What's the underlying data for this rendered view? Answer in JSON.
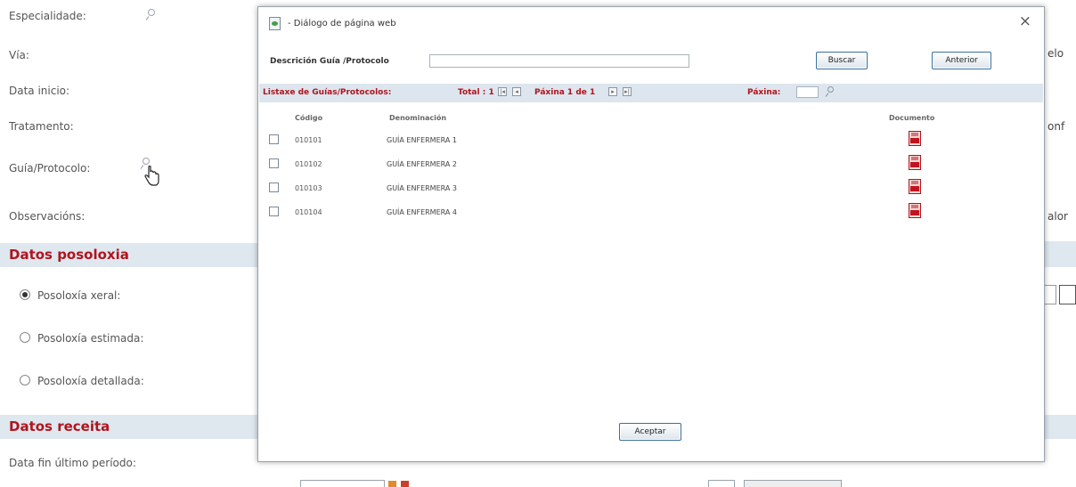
{
  "form": {
    "especialidade": "Especialidade:",
    "via": "Vía:",
    "data_inicio": "Data inicio:",
    "tratamento": "Tratamento:",
    "guia_protocolo": "Guía/Protocolo:",
    "observacions": "Observacións:",
    "right_fragments": {
      "elo": "elo",
      "onf": "onf",
      "alor": "alor"
    }
  },
  "sections": {
    "posoloxia": "Datos posoloxia",
    "receita": "Datos receita"
  },
  "posoloxia_options": [
    {
      "label": "Posoloxía xeral:",
      "selected": true
    },
    {
      "label": "Posoloxía estimada:",
      "selected": false
    },
    {
      "label": "Posoloxía detallada:",
      "selected": false
    }
  ],
  "receita": {
    "data_fin": "Data fin último período:"
  },
  "dialog": {
    "title": "- Diálogo de página web",
    "close": "×",
    "search_label": "Descrición Guía /Protocolo",
    "search_value": "",
    "buttons": {
      "buscar": "Buscar",
      "anterior": "Anterior",
      "aceptar": "Aceptar"
    },
    "toolbar": {
      "listado": "Listaxe de Guías/Protocolos:",
      "total": "Total : 1",
      "pagina_info": "Páxina 1 de 1",
      "pagina_label": "Páxina:"
    },
    "columns": {
      "codigo": "Código",
      "denominacion": "Denominación",
      "documento": "Documento"
    },
    "rows": [
      {
        "code": "010101",
        "name": "GUÍA ENFERMERA 1"
      },
      {
        "code": "010102",
        "name": "GUÍA ENFERMERA 2"
      },
      {
        "code": "010103",
        "name": "GUÍA ENFERMERA 3"
      },
      {
        "code": "010104",
        "name": "GUÍA ENFERMERA 4"
      }
    ]
  },
  "colors": {
    "section_red": "#b0141d",
    "band": "#dfe7ef",
    "button_border": "#3b6f9a"
  },
  "icons": [
    "search-icon",
    "hand-cursor-icon",
    "pdf-icon",
    "page-icon",
    "close-icon",
    "first-page-icon",
    "prev-page-icon",
    "next-page-icon",
    "last-page-icon"
  ]
}
